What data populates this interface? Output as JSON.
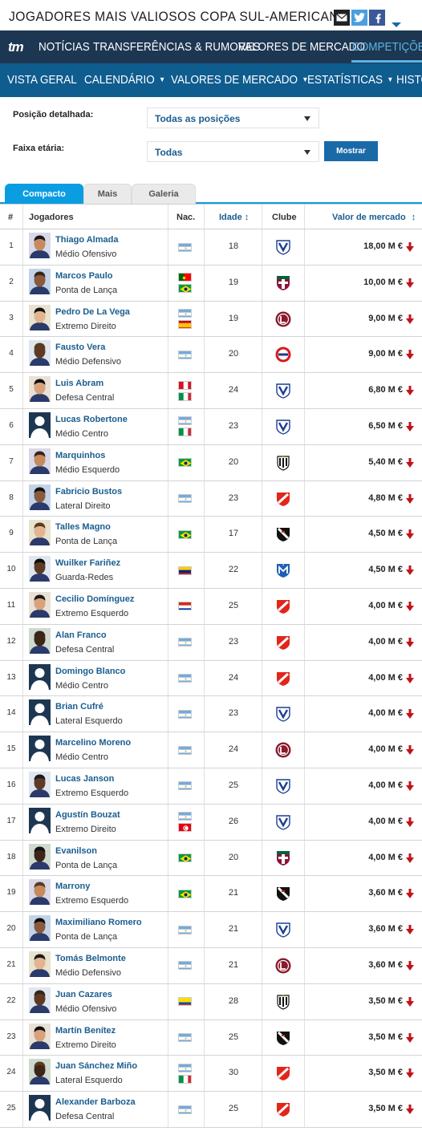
{
  "page": {
    "title": "JOGADORES MAIS VALIOSOS COPA SUL-AMERICANA"
  },
  "nav": {
    "logo": "tm",
    "items": [
      "NOTÍCIAS",
      "TRANSFERÊNCIAS & RUMORES",
      "VALORES DE MERCADO",
      "COMPETIÇÕES"
    ]
  },
  "subnav": {
    "items": [
      "VISTA GERAL",
      "CALENDÁRIO",
      "VALORES DE MERCADO",
      "ESTATÍSTICAS",
      "HISTO"
    ]
  },
  "filters": {
    "position_label": "Posição detalhada:",
    "position_value": "Todas as posições",
    "age_label": "Faixa etária:",
    "age_value": "Todas",
    "submit": "Mostrar"
  },
  "tabs": [
    "Compacto",
    "Mais",
    "Galeria"
  ],
  "table": {
    "headers": {
      "rank": "#",
      "player": "Jogadores",
      "nat": "Nac.",
      "age": "Idade",
      "club": "Clube",
      "value": "Valor de mercado"
    },
    "rows": [
      {
        "rank": "1",
        "name": "Thiago Almada",
        "position": "Médio Ofensivo",
        "flags": [
          "argentina"
        ],
        "age": "18",
        "club": "velez",
        "value": "18,00 M €",
        "photo": "real"
      },
      {
        "rank": "2",
        "name": "Marcos Paulo",
        "position": "Ponta de Lança",
        "flags": [
          "portugal",
          "brazil"
        ],
        "age": "19",
        "club": "fluminense",
        "value": "10,00 M €",
        "photo": "real"
      },
      {
        "rank": "3",
        "name": "Pedro De La Vega",
        "position": "Extremo Direito",
        "flags": [
          "argentina",
          "spain"
        ],
        "age": "19",
        "club": "lanus",
        "value": "9,00 M €",
        "photo": "real"
      },
      {
        "rank": "4",
        "name": "Fausto Vera",
        "position": "Médio Defensivo",
        "flags": [
          "argentina"
        ],
        "age": "20",
        "club": "argentinos",
        "value": "9,00 M €",
        "photo": "real"
      },
      {
        "rank": "5",
        "name": "Luis Abram",
        "position": "Defesa Central",
        "flags": [
          "peru",
          "italy"
        ],
        "age": "24",
        "club": "velez",
        "value": "6,80 M €",
        "photo": "real"
      },
      {
        "rank": "6",
        "name": "Lucas Robertone",
        "position": "Médio Centro",
        "flags": [
          "argentina",
          "italy"
        ],
        "age": "23",
        "club": "velez",
        "value": "6,50 M €",
        "photo": "silhouette"
      },
      {
        "rank": "7",
        "name": "Marquinhos",
        "position": "Médio Esquerdo",
        "flags": [
          "brazil"
        ],
        "age": "20",
        "club": "atletico-mg",
        "value": "5,40 M €",
        "photo": "real"
      },
      {
        "rank": "8",
        "name": "Fabricio Bustos",
        "position": "Lateral Direito",
        "flags": [
          "argentina"
        ],
        "age": "23",
        "club": "independiente",
        "value": "4,80 M €",
        "photo": "real"
      },
      {
        "rank": "9",
        "name": "Talles Magno",
        "position": "Ponta de Lança",
        "flags": [
          "brazil"
        ],
        "age": "17",
        "club": "vasco",
        "value": "4,50 M €",
        "photo": "real"
      },
      {
        "rank": "10",
        "name": "Wuilker Fariñez",
        "position": "Guarda-Redes",
        "flags": [
          "venezuela"
        ],
        "age": "22",
        "club": "millonarios",
        "value": "4,50 M €",
        "photo": "real"
      },
      {
        "rank": "11",
        "name": "Cecilio Domínguez",
        "position": "Extremo Esquerdo",
        "flags": [
          "paraguay"
        ],
        "age": "25",
        "club": "independiente",
        "value": "4,00 M €",
        "photo": "real"
      },
      {
        "rank": "12",
        "name": "Alan Franco",
        "position": "Defesa Central",
        "flags": [
          "argentina"
        ],
        "age": "23",
        "club": "independiente",
        "value": "4,00 M €",
        "photo": "real"
      },
      {
        "rank": "13",
        "name": "Domingo Blanco",
        "position": "Médio Centro",
        "flags": [
          "argentina"
        ],
        "age": "24",
        "club": "independiente",
        "value": "4,00 M €",
        "photo": "silhouette"
      },
      {
        "rank": "14",
        "name": "Brian Cufré",
        "position": "Lateral Esquerdo",
        "flags": [
          "argentina"
        ],
        "age": "23",
        "club": "velez",
        "value": "4,00 M €",
        "photo": "silhouette"
      },
      {
        "rank": "15",
        "name": "Marcelino Moreno",
        "position": "Médio Centro",
        "flags": [
          "argentina"
        ],
        "age": "24",
        "club": "lanus",
        "value": "4,00 M €",
        "photo": "silhouette"
      },
      {
        "rank": "16",
        "name": "Lucas Janson",
        "position": "Extremo Esquerdo",
        "flags": [
          "argentina"
        ],
        "age": "25",
        "club": "velez",
        "value": "4,00 M €",
        "photo": "real"
      },
      {
        "rank": "17",
        "name": "Agustín Bouzat",
        "position": "Extremo Direito",
        "flags": [
          "argentina",
          "tunisia"
        ],
        "age": "26",
        "club": "velez",
        "value": "4,00 M €",
        "photo": "silhouette"
      },
      {
        "rank": "18",
        "name": "Evanilson",
        "position": "Ponta de Lança",
        "flags": [
          "brazil"
        ],
        "age": "20",
        "club": "fluminense",
        "value": "4,00 M €",
        "photo": "real"
      },
      {
        "rank": "19",
        "name": "Marrony",
        "position": "Extremo Esquerdo",
        "flags": [
          "brazil"
        ],
        "age": "21",
        "club": "vasco",
        "value": "3,60 M €",
        "photo": "real"
      },
      {
        "rank": "20",
        "name": "Maximiliano Romero",
        "position": "Ponta de Lança",
        "flags": [
          "argentina"
        ],
        "age": "21",
        "club": "velez",
        "value": "3,60 M €",
        "photo": "real"
      },
      {
        "rank": "21",
        "name": "Tomás Belmonte",
        "position": "Médio Defensivo",
        "flags": [
          "argentina"
        ],
        "age": "21",
        "club": "lanus",
        "value": "3,60 M €",
        "photo": "real"
      },
      {
        "rank": "22",
        "name": "Juan Cazares",
        "position": "Médio Ofensivo",
        "flags": [
          "ecuador"
        ],
        "age": "28",
        "club": "atletico-mg",
        "value": "3,50 M €",
        "photo": "real"
      },
      {
        "rank": "23",
        "name": "Martín Benítez",
        "position": "Extremo Direito",
        "flags": [
          "argentina"
        ],
        "age": "25",
        "club": "vasco",
        "value": "3,50 M €",
        "photo": "real"
      },
      {
        "rank": "24",
        "name": "Juan Sánchez Miño",
        "position": "Lateral Esquerdo",
        "flags": [
          "argentina",
          "italy"
        ],
        "age": "30",
        "club": "independiente",
        "value": "3,50 M €",
        "photo": "real"
      },
      {
        "rank": "25",
        "name": "Alexander Barboza",
        "position": "Defesa Central",
        "flags": [
          "argentina"
        ],
        "age": "25",
        "club": "independiente",
        "value": "3,50 M €",
        "photo": "silhouette"
      }
    ]
  },
  "colors": {
    "nav_bg": "#1d3752",
    "subnav_bg": "#0f5c8f",
    "accent": "#0b9de2",
    "link": "#1a5d8f",
    "down_arrow": "#c0141b"
  }
}
